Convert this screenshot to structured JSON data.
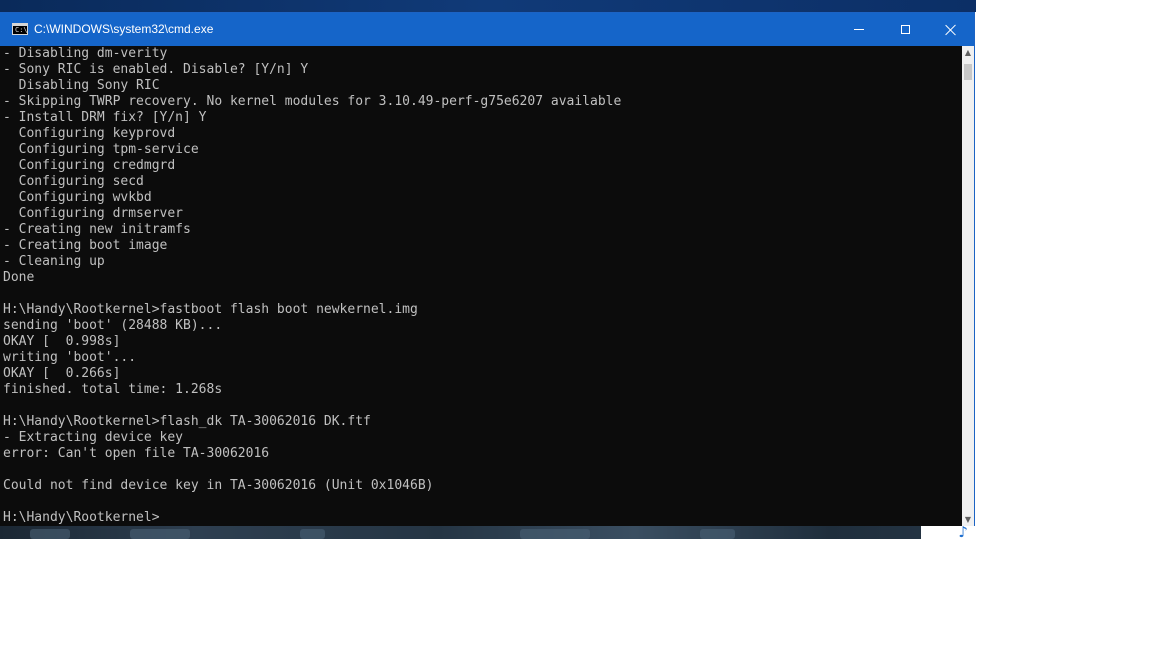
{
  "window": {
    "title": "C:\\WINDOWS\\system32\\cmd.exe",
    "icon_glyph": "C:\\",
    "controls": {
      "minimize": "minimize-icon",
      "maximize": "maximize-icon",
      "close": "close-icon"
    }
  },
  "console": {
    "lines": [
      "- Disabling dm-verity",
      "- Sony RIC is enabled. Disable? [Y/n] Y",
      "  Disabling Sony RIC",
      "- Skipping TWRP recovery. No kernel modules for 3.10.49-perf-g75e6207 available",
      "- Install DRM fix? [Y/n] Y",
      "  Configuring keyprovd",
      "  Configuring tpm-service",
      "  Configuring credmgrd",
      "  Configuring secd",
      "  Configuring wvkbd",
      "  Configuring drmserver",
      "- Creating new initramfs",
      "- Creating boot image",
      "- Cleaning up",
      "Done",
      "",
      "H:\\Handy\\Rootkernel>fastboot flash boot newkernel.img",
      "sending 'boot' (28488 KB)...",
      "OKAY [  0.998s]",
      "writing 'boot'...",
      "OKAY [  0.266s]",
      "finished. total time: 1.268s",
      "",
      "H:\\Handy\\Rootkernel>flash_dk TA-30062016 DK.ftf",
      "- Extracting device key",
      "error: Can't open file TA-30062016",
      "",
      "Could not find device key in TA-30062016 (Unit 0x1046B)",
      "",
      "H:\\Handy\\Rootkernel>"
    ]
  },
  "scrollbar": {
    "up": "▲",
    "down": "▼"
  },
  "taskbar_corner": {
    "icon": "music-note-icon",
    "glyph": "♪"
  },
  "colors": {
    "titlebar": "#1565c9",
    "console_bg": "#0c0c0c",
    "console_fg": "#c0c0c0"
  }
}
